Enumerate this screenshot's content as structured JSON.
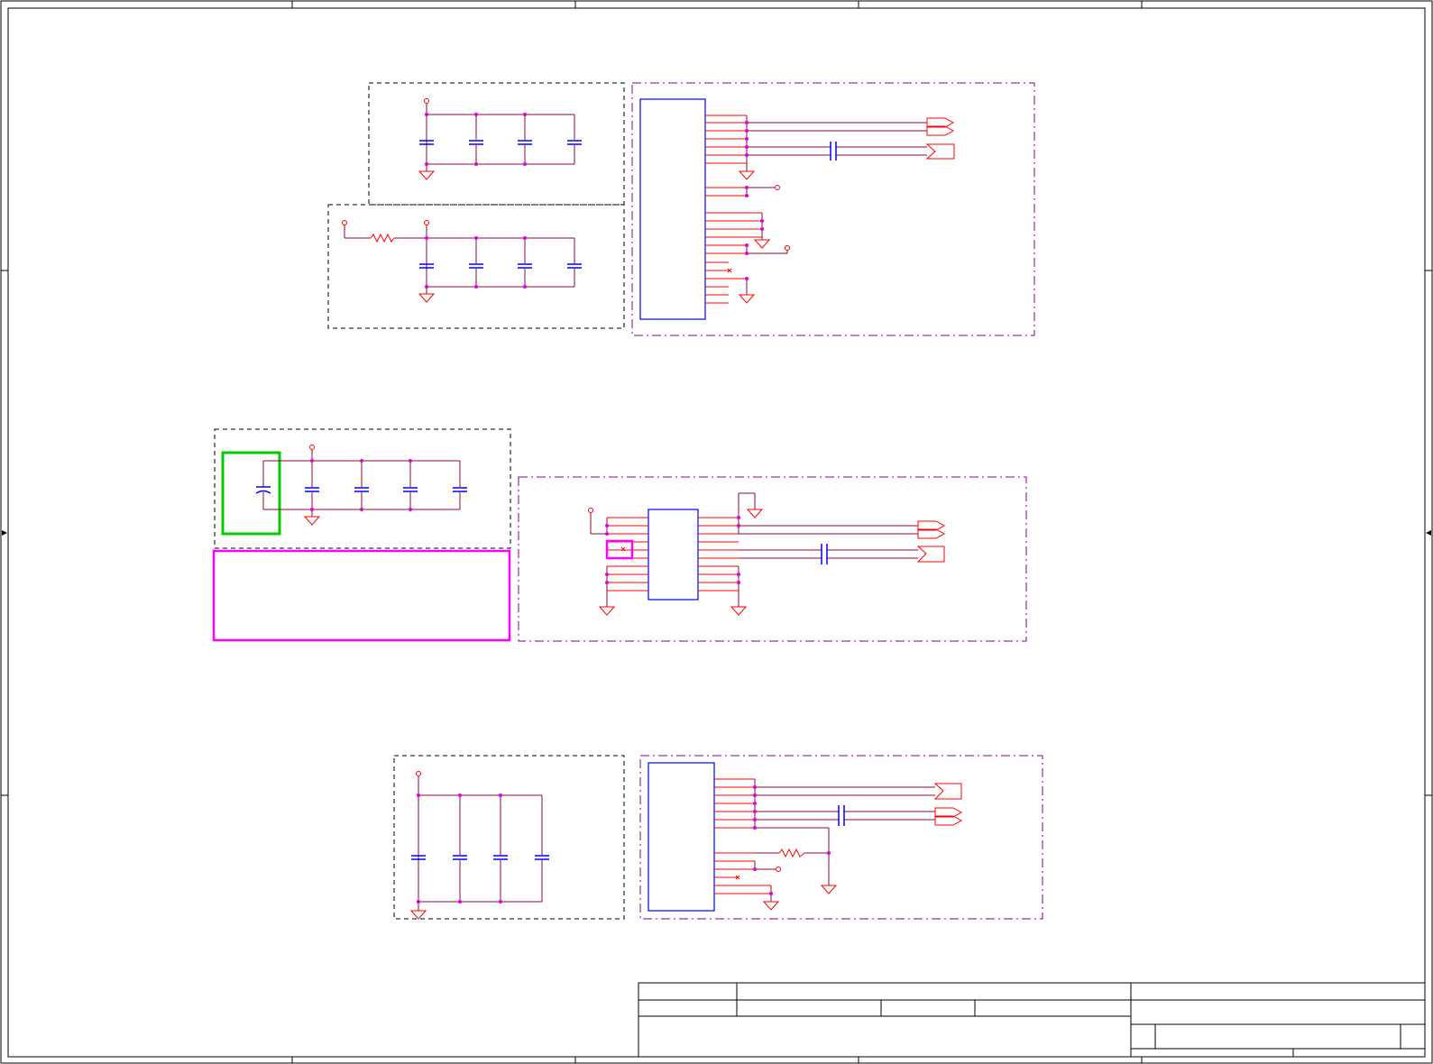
{
  "colors": {
    "frame": "#000000",
    "wire": "#8b0a3a",
    "pin": "#ff0000",
    "junction": "#e000e0",
    "component": "#0000ff",
    "box_dash": "#000000",
    "box_dashdot": "#8a008a",
    "highlight_green": "#00cc00",
    "highlight_magenta": "#ff00ff"
  },
  "sections": [
    {
      "id": "section-1",
      "decoupling_caps": 4,
      "ic_pins_left": 0
    },
    {
      "id": "section-1b",
      "decoupling_caps": 4,
      "series_resistor": true
    },
    {
      "id": "section-2",
      "decoupling_caps": 4,
      "highlighted_cap": true
    },
    {
      "id": "section-3",
      "decoupling_caps": 4,
      "series_resistor": true
    }
  ]
}
